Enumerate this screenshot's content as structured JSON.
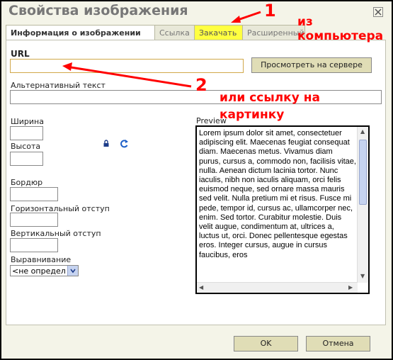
{
  "window": {
    "title": "Свойства изображения"
  },
  "tabs": [
    {
      "label": "Информация о изображении"
    },
    {
      "label": "Ссылка"
    },
    {
      "label": "Закачать"
    },
    {
      "label": "Расширенный"
    }
  ],
  "url": {
    "label": "URL",
    "value": ""
  },
  "browse_button": "Просмотреть на сервере",
  "alt": {
    "label": "Альтернативный текст",
    "value": ""
  },
  "fields": {
    "width": "Ширина",
    "height": "Высота",
    "border": "Бордюр",
    "hspace": "Горизонтальный отступ",
    "vspace": "Вертикальный отступ",
    "align": "Выравнивание",
    "align_value": "<не определ"
  },
  "preview": {
    "label": "Preview",
    "text": "Lorem ipsum dolor sit amet, consectetuer adipiscing elit. Maecenas feugiat consequat diam. Maecenas metus. Vivamus diam purus, cursus a, commodo non, facilisis vitae, nulla. Aenean dictum lacinia tortor. Nunc iaculis, nibh non iaculis aliquam, orci felis euismod neque, sed ornare massa mauris sed velit. Nulla pretium mi et risus. Fusce mi pede, tempor id, cursus ac, ullamcorper nec, enim. Sed tortor. Curabitur molestie. Duis velit augue, condimentum at, ultrices a, luctus ut, orci. Donec pellentesque egestas eros. Integer cursus, augue in cursus faucibus, eros"
  },
  "buttons": {
    "ok": "OK",
    "cancel": "Отмена"
  },
  "annotations": {
    "n1": "1",
    "n2": "2",
    "from_pc": "из\nкомпьютера",
    "or_link": "или ссылку на\nкартинку"
  },
  "colors": {
    "annotation": "#ff0000",
    "highlight": "#ffff40",
    "accent_bar": "#c6d3f0"
  }
}
